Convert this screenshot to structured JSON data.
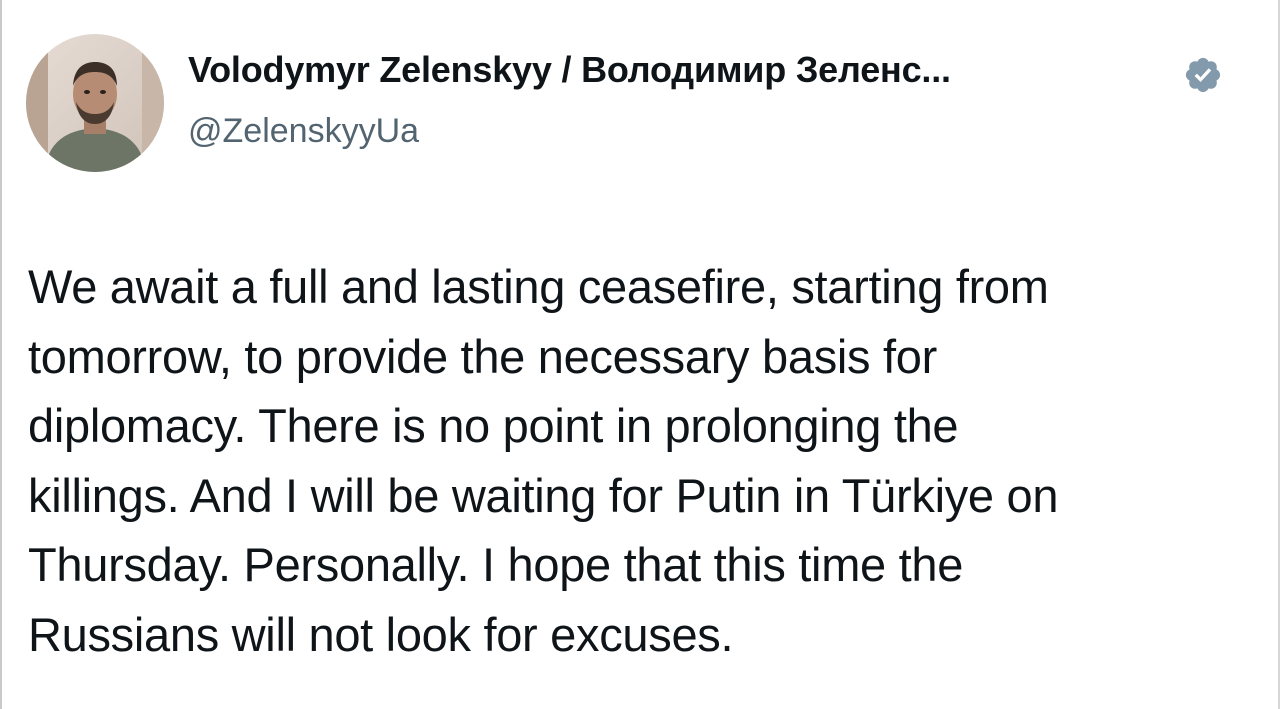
{
  "tweet": {
    "author": {
      "display_name": "Volodymyr Zelenskyy / Володимир Зеленс...",
      "handle": "@ZelenskyyUa",
      "verified": true,
      "avatar_icon": "profile-photo",
      "badge_color": "#829aab"
    },
    "text_lines": [
      "We await a full and lasting ceasefire, starting from",
      "tomorrow, to provide the necessary basis for",
      "diplomacy. There is no point in prolonging the",
      "killings. And I will be waiting for Putin in Türkiye on",
      "Thursday. Personally. I hope that this time the",
      "Russians will not look for excuses."
    ]
  }
}
